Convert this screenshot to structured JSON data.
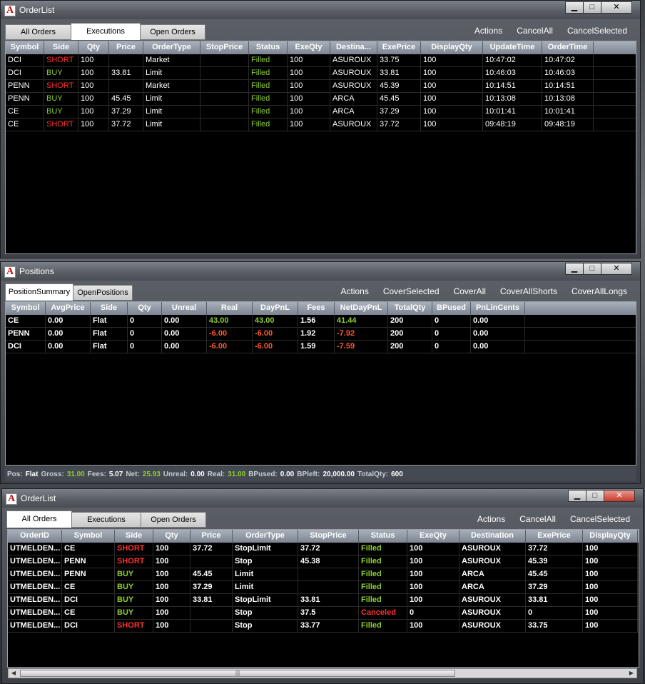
{
  "win1": {
    "title": "OrderList",
    "controls": {
      "min": "▁",
      "max": "□",
      "close": "✕"
    },
    "tabs": [
      "All Orders",
      "Executions",
      "Open Orders"
    ],
    "active_tab": 1,
    "actions": [
      "Actions",
      "CancelAll",
      "CancelSelected"
    ],
    "columns": [
      "Symbol",
      "Side",
      "Qty",
      "Price",
      "OrderType",
      "StopPrice",
      "Status",
      "ExeQty",
      "Destina...",
      "ExePrice",
      "DisplayQty",
      "UpdateTime",
      "OrderTime"
    ],
    "rows": [
      [
        "DCI",
        "SHORT",
        "100",
        "",
        "Market",
        "",
        "Filled",
        "100",
        "ASUROUX",
        "33.75",
        "100",
        "10:47:02",
        "10:47:02"
      ],
      [
        "DCI",
        "BUY",
        "100",
        "33.81",
        "Limit",
        "",
        "Filled",
        "100",
        "ASUROUX",
        "33.81",
        "100",
        "10:46:03",
        "10:46:03"
      ],
      [
        "PENN",
        "SHORT",
        "100",
        "",
        "Market",
        "",
        "Filled",
        "100",
        "ASUROUX",
        "45.39",
        "100",
        "10:14:51",
        "10:14:51"
      ],
      [
        "PENN",
        "BUY",
        "100",
        "45.45",
        "Limit",
        "",
        "Filled",
        "100",
        "ARCA",
        "45.45",
        "100",
        "10:13:08",
        "10:13:08"
      ],
      [
        "CE",
        "BUY",
        "100",
        "37.29",
        "Limit",
        "",
        "Filled",
        "100",
        "ARCA",
        "37.29",
        "100",
        "10:01:41",
        "10:01:41"
      ],
      [
        "CE",
        "SHORT",
        "100",
        "37.72",
        "Limit",
        "",
        "Filled",
        "100",
        "ASUROUX",
        "37.72",
        "100",
        "09:48:19",
        "09:48:19"
      ]
    ]
  },
  "win2": {
    "title": "Positions",
    "controls": {
      "min": "▁",
      "max": "□",
      "close": "✕"
    },
    "tabs": [
      "PositionSummary",
      "OpenPositions"
    ],
    "active_tab": 0,
    "actions": [
      "Actions",
      "CoverSelected",
      "CoverAll",
      "CoverAllShorts",
      "CoverAllLongs"
    ],
    "columns": [
      "Symbol",
      "AvgPrice",
      "Side",
      "Qty",
      "Unreal",
      "Real",
      "DayPnL",
      "Fees",
      "NetDayPnL",
      "TotalQty",
      "BPused",
      "PnLinCents"
    ],
    "rows": [
      [
        "CE",
        "0.00",
        "Flat",
        "0",
        "0.00",
        "43.00",
        "43.00",
        "1.56",
        "41.44",
        "200",
        "0",
        "0.00"
      ],
      [
        "PENN",
        "0.00",
        "Flat",
        "0",
        "0.00",
        "-6.00",
        "-6.00",
        "1.92",
        "-7.92",
        "200",
        "0",
        "0.00"
      ],
      [
        "DCI",
        "0.00",
        "Flat",
        "0",
        "0.00",
        "-6.00",
        "-6.00",
        "1.59",
        "-7.59",
        "200",
        "0",
        "0.00"
      ]
    ],
    "status": {
      "pos_label": "Pos:",
      "pos": "Flat",
      "gross_label": "Gross:",
      "gross": "31.00",
      "fees_label": "Fees:",
      "fees": "5.07",
      "net_label": "Net:",
      "net": "25.93",
      "unreal_label": "Unreal:",
      "unreal": "0.00",
      "real_label": "Real:",
      "real": "31.00",
      "bpused_label": "BPused:",
      "bpused": "0.00",
      "bpleft_label": "BPleft:",
      "bpleft": "20,000.00",
      "totalqty_label": "TotalQty:",
      "totalqty": "600"
    }
  },
  "win3": {
    "title": "OrderList",
    "controls": {
      "min": "▁",
      "max": "□",
      "close": "✕"
    },
    "tabs": [
      "All Orders",
      "Executions",
      "Open Orders"
    ],
    "active_tab": 0,
    "actions": [
      "Actions",
      "CancelAll",
      "CancelSelected"
    ],
    "columns": [
      "OrderID",
      "Symbol",
      "Side",
      "Qty",
      "Price",
      "OrderType",
      "StopPrice",
      "Status",
      "ExeQty",
      "Destination",
      "ExePrice",
      "DisplayQty"
    ],
    "rows": [
      [
        "UTMELDEN...",
        "CE",
        "SHORT",
        "100",
        "37.72",
        "StopLimit",
        "37.72",
        "Filled",
        "100",
        "ASUROUX",
        "37.72",
        "100"
      ],
      [
        "UTMELDEN...",
        "PENN",
        "SHORT",
        "100",
        "",
        "Stop",
        "45.38",
        "Filled",
        "100",
        "ASUROUX",
        "45.39",
        "100"
      ],
      [
        "UTMELDEN...",
        "PENN",
        "BUY",
        "100",
        "45.45",
        "Limit",
        "",
        "Filled",
        "100",
        "ARCA",
        "45.45",
        "100"
      ],
      [
        "UTMELDEN...",
        "CE",
        "BUY",
        "100",
        "37.29",
        "Limit",
        "",
        "Filled",
        "100",
        "ARCA",
        "37.29",
        "100"
      ],
      [
        "UTMELDEN...",
        "DCI",
        "BUY",
        "100",
        "33.81",
        "StopLimit",
        "33.81",
        "Filled",
        "100",
        "ASUROUX",
        "33.81",
        "100"
      ],
      [
        "UTMELDEN...",
        "CE",
        "BUY",
        "100",
        "",
        "Stop",
        "37.5",
        "Canceled",
        "0",
        "ASUROUX",
        "0",
        "100"
      ],
      [
        "UTMELDEN...",
        "DCI",
        "SHORT",
        "100",
        "",
        "Stop",
        "33.77",
        "Filled",
        "100",
        "ASUROUX",
        "33.75",
        "100"
      ]
    ],
    "scroll_grip": "|||"
  },
  "colors": {
    "buy": "#8ccf2e",
    "short": "#ff3030",
    "filled": "#8ccf2e",
    "canceled": "#ff3030",
    "negative": "#ff5a2a"
  }
}
